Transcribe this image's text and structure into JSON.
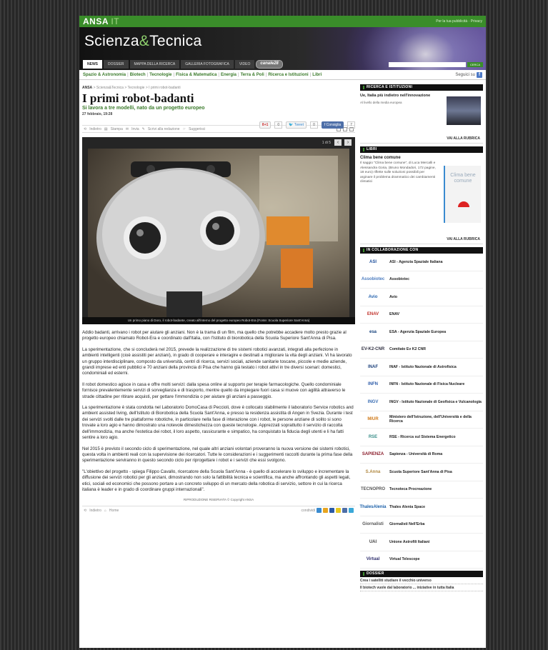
{
  "header": {
    "logo_main": "ANSA",
    "logo_sub": "IT",
    "top_links": "Per la tua pubblicità · Privacy"
  },
  "banner": {
    "title_a": "Scienza",
    "title_amp": "&",
    "title_b": "Tecnica",
    "search_button": "CERCA"
  },
  "nav": {
    "tabs": [
      "NEWS",
      "DOSSIER",
      "MAPPA DELLA RICERCA",
      "GALLERIA FOTOGRAFICA",
      "VIDEO"
    ],
    "channel": "canale28"
  },
  "subnav": {
    "items": [
      "Spazio & Astronomia",
      "Biotech",
      "Tecnologie",
      "Fisica & Matematica",
      "Energia",
      "Terra & Poli",
      "Ricerca e Istituzioni",
      "Libri"
    ],
    "follow": "Seguici su"
  },
  "article": {
    "breadcrumb_home": "ANSA",
    "breadcrumb_rest": "> Scienza&Tecnica > Tecnologie > I primi robot-badanti",
    "title": "I primi robot-badanti",
    "subtitle": "Si lavora a tre modelli, nato da un progetto europeo",
    "date": "27 febbraio, 19:28",
    "social": {
      "gplus": "8+1",
      "gplus_count": "0",
      "tweet": "Tweet",
      "tweet_count": "0",
      "like": "Consiglia",
      "like_count": "7"
    },
    "tools": [
      "Indietro",
      "Stampa",
      "Invia",
      "Scrivi alla redazione",
      "Suggerisci"
    ],
    "photo_counter": "1 di 5",
    "photo_caption": "Un primo piano di Doro, il robot-badante, creato all'interno del progetto europeo Robot-Era (Fonte: Scuola Superiore Sant'Anna)",
    "paragraphs": [
      "Addio badanti, arrivano i robot per aiutare gli anziani. Non è la trama di un film, ma quello che potrebbe accadere molto presto grazie al progetto europeo chiamato Robot-Era e coordinato dall'Italia, con l'Istituto di biorobotica della Scuola Superiore Sant'Anna di Pisa.",
      "La sperimentazione, che si concluderà nel 2015, prevede la realizzazione di tre sistemi robotici avanzati, integrati alla perfezione in ambienti intelligenti (cioè assistiti per anziani), in grado di cooperare e interagire e destinati a migliorare la vita degli anziani. Vi ha lavorato un gruppo interdisciplinare, composto da università, centri di ricerca, servizi sociali, aziende sanitarie toscane, piccole e medie aziende, grandi imprese ed enti pubblici e 70 anziani della provincia di Pisa che hanno già testato i robot attivi in tre diversi scenari: domestici, condominiali ed esterni.",
      "Il robot domestico agisce in casa e offre molti servizi: dalla spesa online al supporto per terapie farmacologiche. Quello condominiale fornisce prevalentemente servizi di sorveglianza e di trasporto, mentre quello da impiegare fuori casa si muove con agilità attraverso le strade cittadine per ritirare acquisti, per gettare l'immondizia o per aiutare gli anziani a passeggio.",
      "La sperimentazione è stata condotta nel Laboratorio DomoCasa di Peccioli, dove è collocato stabilmente il laboratorio Service robotics and ambient assisted living, dell'Istituto di Biorobotica della Scuola Sant'Anna, e presso la residenza assistita di Angen in Svezia. Durante i test dei servizi svolti dalle tre piattaforme robotiche, in particolare nella fase di interazione con i robot, le persone anziane di solito si sono trovate a loro agio e hanno dimostrato una notevole dimestichezza con queste tecnologie. Apprezzati soprattutto il servizio di raccolta dell'immondizia, ma anche l'estetica dei robot, il loro aspetto, rassicurante e simpatico, ha conquistato la fiducia degli utenti e li ha fatti sentire a loro agio.",
      "Nel 2015 è previsto il secondo ciclo di sperimentazione, nel quale altri anziani volontari proveranno la nuova versione dei sistemi robotici, questa volta in ambienti reali con la supervisione dei ricercatori. Tutte le considerazioni e i suggerimenti raccolti durante la prima fase della sperimentazione serviranno in questo secondo ciclo per riprogettare i robot e i servizi che essi svolgono.",
      "\"L'obiettivo del progetto - spiega Filippo Cavallo, ricercatore della Scuola Sant'Anna - è quello di accelerare lo sviluppo e incrementare la diffusione dei servizi robotici per gli anziani, dimostrando non solo la fattibilità tecnica e scientifica, ma anche affrontando gli aspetti legali, etici, sociali ed economici che possono portare a un concreto sviluppo di un mercato della robotica di servizio, settore in cui la ricerca italiana è leader e in grado di coordinare gruppi internazionali\"."
    ],
    "reproduction": "RIPRODUZIONE RISERVATA © Copyright ANSA",
    "footer_tools": [
      "Indietro",
      "Home"
    ],
    "share_label": "condividi"
  },
  "sidebar": {
    "ricerca": {
      "heading": "RICERCA E ISTITUZIONI",
      "title": "Ue, Italia più indietro nell'innovazione",
      "sub": "Al livello della media europea",
      "more": "VAI ALLA RUBRICA"
    },
    "libri": {
      "heading": "LIBRI",
      "title": "Clima bene comune",
      "desc": "Il saggio \"Clima bene comune\", di Luca Mercalli e Alessandra Goria, (Bruno Mondadori, 172 pagine, 18 euro) riflette sulle soluzioni possibili per arginare il problema drammatico dei cambiamenti climatici",
      "book_title": "Clima bene comune",
      "more": "VAI ALLA RUBRICA"
    },
    "collab": {
      "heading": "IN COLLABORAZIONE CON",
      "items": [
        {
          "logo": "ASI",
          "name": "ASI - Agenzia Spaziale Italiana",
          "color": "#1a4c9a"
        },
        {
          "logo": "Assobiotec",
          "name": "Assobiotec",
          "color": "#4a7bbf"
        },
        {
          "logo": "Avio",
          "name": "Avio",
          "color": "#2a66b0"
        },
        {
          "logo": "ENAV",
          "name": "ENAV",
          "color": "#c0302a"
        },
        {
          "logo": "esa",
          "name": "ESA - Agenzia Spaziale Europea",
          "color": "#113e7a"
        },
        {
          "logo": "EV-K2-CNR",
          "name": "Comitato Ev K2 CNR",
          "color": "#334"
        },
        {
          "logo": "INAF",
          "name": "INAF - Istituto Nazionale di Astrofisica",
          "color": "#1a3f7a"
        },
        {
          "logo": "INFN",
          "name": "INFN - Istituto Nazionale di Fisica Nucleare",
          "color": "#2b5aa8"
        },
        {
          "logo": "INGV",
          "name": "INGV - Istituto Nazionale di Geofisica e Vulcanologia",
          "color": "#3a6db3"
        },
        {
          "logo": "MIUR",
          "name": "Ministero dell'Istruzione, dell'Università e della Ricerca",
          "color": "#d07a1a"
        },
        {
          "logo": "RSE",
          "name": "RSE - Ricerca sul Sistema Energetico",
          "color": "#3b8f8a"
        },
        {
          "logo": "SAPIENZA",
          "name": "Sapienza - Università di Roma",
          "color": "#8a1d2b"
        },
        {
          "logo": "S.Anna",
          "name": "Scuola Superiore Sant'Anna di Pisa",
          "color": "#b08840"
        },
        {
          "logo": "TECNOPRO",
          "name": "Tecnoteca Procreazione",
          "color": "#555"
        },
        {
          "logo": "ThalesAlenia",
          "name": "Thales Alenia Space",
          "color": "#1a5fa8"
        },
        {
          "logo": "Giornalisti",
          "name": "Giornalisti Nell'Erba",
          "color": "#555"
        },
        {
          "logo": "UAI",
          "name": "Unione Astrofili Italiani",
          "color": "#444"
        },
        {
          "logo": "Virtual",
          "name": "Virtual Telescope",
          "color": "#2a2a6a"
        }
      ]
    },
    "dossier": {
      "heading": "DOSSIER",
      "items": [
        "Crea i satelliti studiare il vecchio universo",
        "Il biotech vuole dal laboratorio ... iniziative in tutta Italia"
      ]
    }
  }
}
